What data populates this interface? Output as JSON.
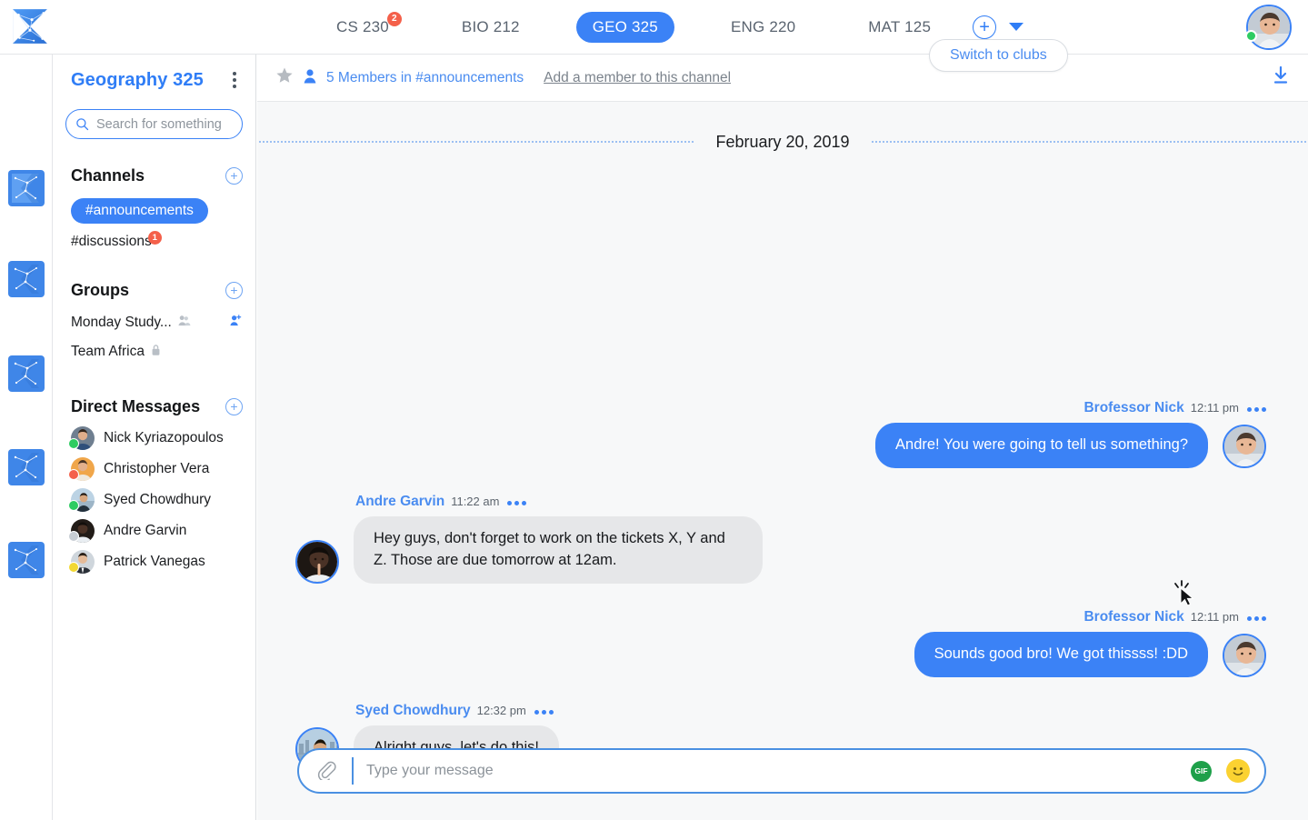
{
  "app": {
    "logo_icon": "k-network-logo"
  },
  "topbar": {
    "tabs": [
      {
        "label": "CS 230",
        "active": false,
        "badge": "2"
      },
      {
        "label": "BIO 212",
        "active": false,
        "badge": ""
      },
      {
        "label": "GEO 325",
        "active": true,
        "badge": ""
      },
      {
        "label": "ENG 220",
        "active": false,
        "badge": ""
      },
      {
        "label": "MAT 125",
        "active": false,
        "badge": ""
      }
    ],
    "add_tab_icon": "plus-circle-icon",
    "dropdown_icon": "caret-down-icon",
    "switch_popup_label": "Switch to clubs",
    "avatar_icon": "user-avatar",
    "status_color": "#2ecc62"
  },
  "rail": {
    "items": [
      {
        "name": "workspace-1",
        "icon": "k-network-logo"
      },
      {
        "name": "workspace-2",
        "icon": "k-network-logo"
      },
      {
        "name": "workspace-3",
        "icon": "k-network-logo"
      },
      {
        "name": "workspace-4",
        "icon": "k-network-logo"
      },
      {
        "name": "workspace-5",
        "icon": "k-network-logo"
      }
    ]
  },
  "sidebar": {
    "title": "Geography 325",
    "menu_icon": "kebab-menu-icon",
    "search": {
      "placeholder": "Search for something",
      "value": "",
      "icon": "search-icon"
    },
    "sections": [
      {
        "label": "Channels",
        "add_icon": "plus-icon"
      },
      {
        "label": "Groups",
        "add_icon": "plus-icon"
      },
      {
        "label": "Direct Messages",
        "add_icon": "plus-icon"
      }
    ],
    "channels": [
      {
        "label": "#announcements",
        "active": true,
        "badge": ""
      },
      {
        "label": "#discussions",
        "active": false,
        "badge": "1"
      }
    ],
    "groups": [
      {
        "label": "Monday Study...",
        "icon": "group-people-icon",
        "action_icon": "add-person-icon"
      },
      {
        "label": "Team Africa",
        "icon": "lock-icon",
        "action_icon": ""
      }
    ],
    "direct_messages": [
      {
        "name": "Nick Kyriazopoulos",
        "status": "#2ecc62"
      },
      {
        "name": "Christopher Vera",
        "status": "#f4604a"
      },
      {
        "name": "Syed Chowdhury",
        "status": "#2ecc62"
      },
      {
        "name": "Andre Garvin",
        "status": "#c7cdd3"
      },
      {
        "name": "Patrick Vanegas",
        "status": "#f2d832"
      }
    ]
  },
  "channel_header": {
    "star_icon": "star-icon",
    "member_icon": "person-icon",
    "members_label": "5 Members in #announcements",
    "add_member_label": "Add a member to this channel",
    "download_icon": "download-icon"
  },
  "conversation": {
    "date_divider": "February 20, 2019",
    "messages": [
      {
        "author": "Brofessor Nick",
        "time": "12:11 pm",
        "text": "Andre! You were going to tell us something?",
        "side": "right",
        "options_icon": "more-options-icon"
      },
      {
        "author": "Andre Garvin",
        "time": "11:22 am",
        "text": "Hey guys, don't forget to work on the tickets X, Y and Z. Those are due tomorrow at 12am.",
        "side": "left",
        "options_icon": "more-options-icon"
      },
      {
        "author": "Brofessor Nick",
        "time": "12:11 pm",
        "text": "Sounds good bro! We got thissss! :DD",
        "side": "right",
        "options_icon": "more-options-icon"
      },
      {
        "author": "Syed Chowdhury",
        "time": "12:32 pm",
        "text": "Alright guys, let's do this!",
        "side": "left",
        "options_icon": "more-options-icon"
      }
    ]
  },
  "composer": {
    "attach_icon": "paperclip-icon",
    "placeholder": "Type your message",
    "value": "",
    "gif_label": "GIF",
    "emoji_icon": "smiley-icon"
  },
  "cursor": {
    "icon": "mouse-click-cursor"
  },
  "colors": {
    "accent": "#3b82f6",
    "link": "#4a8cf0",
    "badge": "#f4604a",
    "bubble_incoming": "#e6e7e9",
    "chat_bg": "#f7f8f9"
  }
}
